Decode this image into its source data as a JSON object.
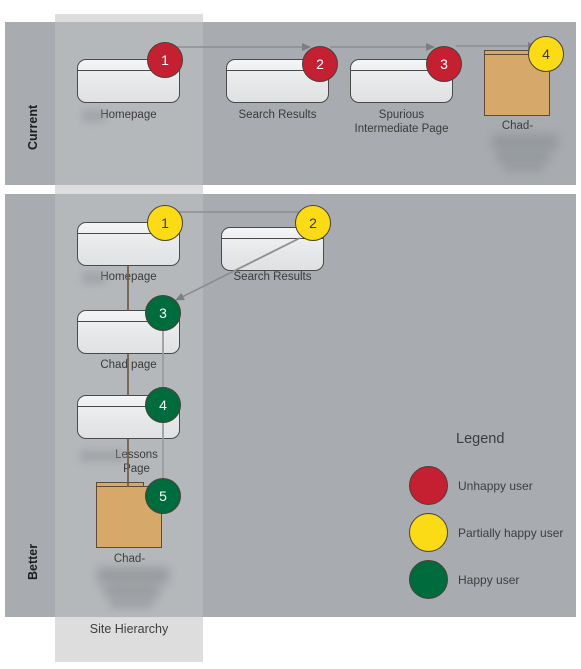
{
  "diagram": {
    "title_hierarchy_axis": "Site Hierarchy",
    "sections": [
      {
        "key": "current",
        "label": "Current"
      },
      {
        "key": "better",
        "label": "Better"
      }
    ],
    "current_flow": {
      "steps": [
        {
          "number": "1",
          "state": "red",
          "label": "Homepage"
        },
        {
          "number": "2",
          "state": "red",
          "label": "Search Results"
        },
        {
          "number": "3",
          "state": "red",
          "label": "Spurious\nIntermediate Page"
        },
        {
          "number": "4",
          "state": "yellow",
          "label": "Chad-"
        }
      ]
    },
    "better_flow": {
      "steps": [
        {
          "number": "1",
          "state": "yellow",
          "label": "Homepage"
        },
        {
          "number": "2",
          "state": "yellow",
          "label": "Search Results"
        },
        {
          "number": "3",
          "state": "green",
          "label": "Chad page"
        },
        {
          "number": "4",
          "state": "green",
          "label": "Lessons\nPage"
        },
        {
          "number": "5",
          "state": "green",
          "label": "Chad-"
        }
      ]
    },
    "legend": {
      "title": "Legend",
      "items": [
        {
          "color_name": "red",
          "color": "#c42032",
          "label": "Unhappy user"
        },
        {
          "color_name": "yellow",
          "color": "#fbdb16",
          "label": "Partially happy user"
        },
        {
          "color_name": "green",
          "color": "#006b3c",
          "label": "Happy user"
        }
      ]
    },
    "colors": {
      "band": "#a8acb0",
      "hierarchy_band": "#dddddd",
      "page_fill": "#e9ebed",
      "folder_fill": "#d6a96a",
      "arrow": "#7b7f83"
    }
  }
}
